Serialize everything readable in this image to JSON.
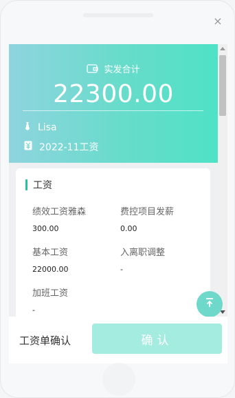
{
  "window": {
    "close_label": "×"
  },
  "hero": {
    "title": "实发合计",
    "amount": "22300.00",
    "user": "Lisa",
    "period": "2022-11工资"
  },
  "section": {
    "title": "工资",
    "fields": [
      {
        "label": "绩效工资雅森",
        "value": "300.00"
      },
      {
        "label": "费控项目发薪",
        "value": "0.00"
      },
      {
        "label": "基本工资",
        "value": "22000.00"
      },
      {
        "label": "入离职调整",
        "value": "-"
      },
      {
        "label": "加班工资",
        "value": "-"
      }
    ]
  },
  "footer": {
    "label": "工资单确认",
    "confirm_label": "确认"
  },
  "colors": {
    "accent": "#28c0a0",
    "hero_start": "#8fd4de",
    "hero_end": "#4fe2c6",
    "button": "#a4ece0"
  }
}
